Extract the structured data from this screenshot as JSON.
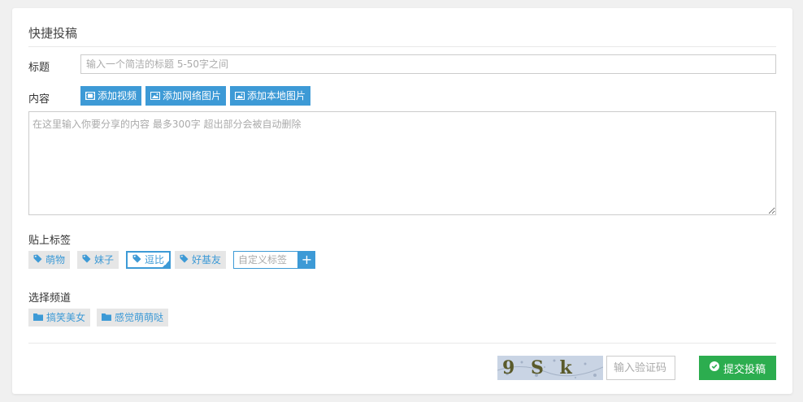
{
  "form": {
    "title": "快捷投稿",
    "title_label": "标题",
    "title_placeholder": "输入一个简洁的标题 5-50字之间",
    "content_label": "内容",
    "content_placeholder": "在这里输入你要分享的内容 最多300字 超出部分会被自动删除",
    "media_buttons": {
      "video": "添加视频",
      "web_image": "添加网络图片",
      "local_image": "添加本地图片"
    },
    "tags_label": "贴上标签",
    "tags": [
      "萌物",
      "妹子",
      "逗比",
      "好基友"
    ],
    "selected_tag_index": 2,
    "custom_tag_placeholder": "自定义标签",
    "custom_tag_add": "+",
    "channel_label": "选择频道",
    "channels": [
      "搞笑美女",
      "感觉萌萌哒"
    ],
    "captcha_text": "9 S k m",
    "captcha_placeholder": "输入验证码",
    "submit_label": "提交投稿"
  },
  "colors": {
    "accent": "#3d9ad6",
    "submit": "#2cad4f",
    "tag_bg": "#e6e6e6"
  }
}
